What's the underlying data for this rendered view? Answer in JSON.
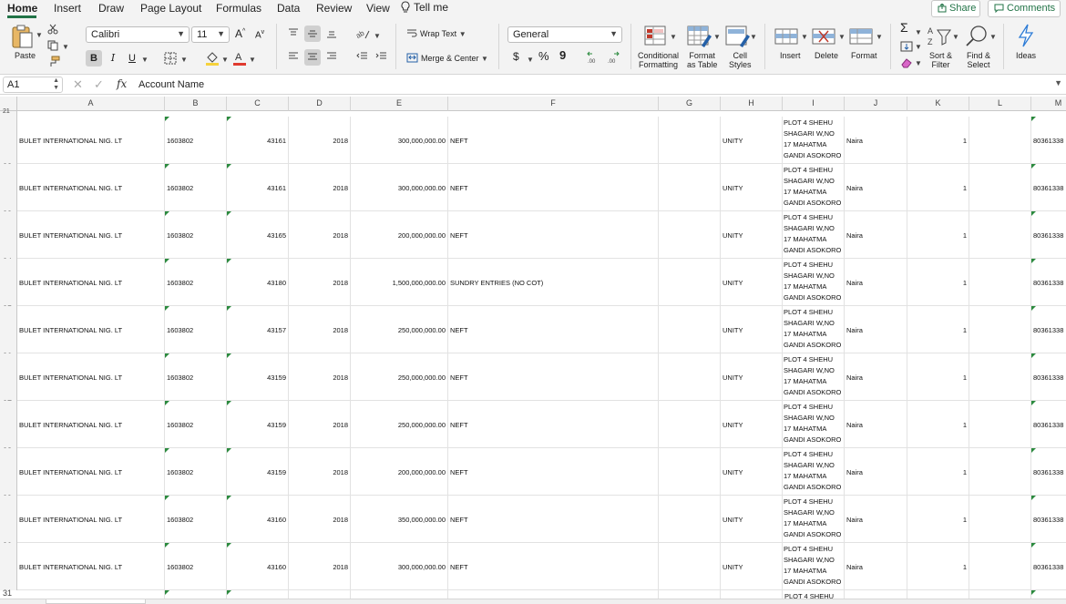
{
  "tabs": {
    "home": "Home",
    "insert": "Insert",
    "draw": "Draw",
    "page_layout": "Page Layout",
    "formulas": "Formulas",
    "data": "Data",
    "review": "Review",
    "view": "View",
    "tell_me": "Tell me",
    "share": "Share",
    "comments": "Comments"
  },
  "ribbon": {
    "paste": "Paste",
    "font_name": "Calibri",
    "font_size": "11",
    "bold": "B",
    "italic": "I",
    "underline": "U",
    "wrap_text": "Wrap Text",
    "merge_center": "Merge & Center",
    "number_format": "General",
    "dollar": "$",
    "percent": "%",
    "comma": "9",
    "conditional_formatting_1": "Conditional",
    "conditional_formatting_2": "Formatting",
    "format_as_table_1": "Format",
    "format_as_table_2": "as Table",
    "cell_styles_1": "Cell",
    "cell_styles_2": "Styles",
    "insert": "Insert",
    "delete": "Delete",
    "format": "Format",
    "sort_filter_1": "Sort &",
    "sort_filter_2": "Filter",
    "find_select_1": "Find &",
    "find_select_2": "Select",
    "ideas": "Ideas",
    "colors": {
      "accent": "#217346",
      "font_color": "#e03a2f",
      "fill_color": "#f6d23c"
    }
  },
  "formula_bar": {
    "name_box": "A1",
    "fx": "fx",
    "value": "Account Name"
  },
  "columns": [
    "A",
    "B",
    "C",
    "D",
    "E",
    "F",
    "G",
    "H",
    "I",
    "J",
    "K",
    "L",
    "M"
  ],
  "first_row_number": "21",
  "rows": [
    {
      "num": "22",
      "a": "BULET INTERNATIONAL  NIG.  LT",
      "b": "1603802",
      "c": "43161",
      "d": "2018",
      "e": "300,000,000.00",
      "f": "NEFT",
      "h": "UNITY",
      "i": "PLOT 4   SHEHU SHAGARI  W,NO 17 MAHATMA GANDI ASOKORO",
      "j": "Naira",
      "k": "1",
      "m": "80361338"
    },
    {
      "num": "23",
      "a": "BULET INTERNATIONAL  NIG.  LT",
      "b": "1603802",
      "c": "43161",
      "d": "2018",
      "e": "300,000,000.00",
      "f": "NEFT",
      "h": "UNITY",
      "i": "PLOT 4   SHEHU SHAGARI  W,NO 17 MAHATMA GANDI ASOKORO",
      "j": "Naira",
      "k": "1",
      "m": "80361338"
    },
    {
      "num": "24",
      "a": "BULET INTERNATIONAL  NIG.  LT",
      "b": "1603802",
      "c": "43165",
      "d": "2018",
      "e": "200,000,000.00",
      "f": "NEFT",
      "h": "UNITY",
      "i": "PLOT 4   SHEHU SHAGARI  W,NO 17 MAHATMA GANDI ASOKORO",
      "j": "Naira",
      "k": "1",
      "m": "80361338"
    },
    {
      "num": "25",
      "a": "BULET INTERNATIONAL  NIG.  LT",
      "b": "1603802",
      "c": "43180",
      "d": "2018",
      "e": "1,500,000,000.00",
      "f": "SUNDRY ENTRIES (NO COT)",
      "h": "UNITY",
      "i": "PLOT 4   SHEHU SHAGARI  W,NO 17 MAHATMA GANDI ASOKORO",
      "j": "Naira",
      "k": "1",
      "m": "80361338"
    },
    {
      "num": "26",
      "a": "BULET INTERNATIONAL  NIG.  LT",
      "b": "1603802",
      "c": "43157",
      "d": "2018",
      "e": "250,000,000.00",
      "f": "NEFT",
      "h": "UNITY",
      "i": "PLOT 4   SHEHU SHAGARI  W,NO 17 MAHATMA GANDI ASOKORO",
      "j": "Naira",
      "k": "1",
      "m": "80361338"
    },
    {
      "num": "27",
      "a": "BULET INTERNATIONAL  NIG.  LT",
      "b": "1603802",
      "c": "43159",
      "d": "2018",
      "e": "250,000,000.00",
      "f": "NEFT",
      "h": "UNITY",
      "i": "PLOT 4   SHEHU SHAGARI  W,NO 17 MAHATMA GANDI ASOKORO",
      "j": "Naira",
      "k": "1",
      "m": "80361338"
    },
    {
      "num": "28",
      "a": "BULET INTERNATIONAL  NIG.  LT",
      "b": "1603802",
      "c": "43159",
      "d": "2018",
      "e": "250,000,000.00",
      "f": "NEFT",
      "h": "UNITY",
      "i": "PLOT 4   SHEHU SHAGARI  W,NO 17 MAHATMA GANDI ASOKORO",
      "j": "Naira",
      "k": "1",
      "m": "80361338"
    },
    {
      "num": "29",
      "a": "BULET INTERNATIONAL  NIG.  LT",
      "b": "1603802",
      "c": "43159",
      "d": "2018",
      "e": "200,000,000.00",
      "f": "NEFT",
      "h": "UNITY",
      "i": "PLOT 4   SHEHU SHAGARI  W,NO 17 MAHATMA GANDI ASOKORO",
      "j": "Naira",
      "k": "1",
      "m": "80361338"
    },
    {
      "num": "30",
      "a": "BULET INTERNATIONAL  NIG.  LT",
      "b": "1603802",
      "c": "43160",
      "d": "2018",
      "e": "350,000,000.00",
      "f": "NEFT",
      "h": "UNITY",
      "i": "PLOT 4   SHEHU SHAGARI  W,NO 17 MAHATMA GANDI ASOKORO",
      "j": "Naira",
      "k": "1",
      "m": "80361338"
    },
    {
      "num": "31",
      "a": "BULET INTERNATIONAL  NIG.  LT",
      "b": "1603802",
      "c": "43160",
      "d": "2018",
      "e": "300,000,000.00",
      "f": "NEFT",
      "h": "UNITY",
      "i": "PLOT 4   SHEHU SHAGARI  W,NO 17 MAHATMA GANDI ASOKORO",
      "j": "Naira",
      "k": "1",
      "m": "80361338"
    }
  ],
  "partial_row_text": "PLOT 4   SHEHU"
}
